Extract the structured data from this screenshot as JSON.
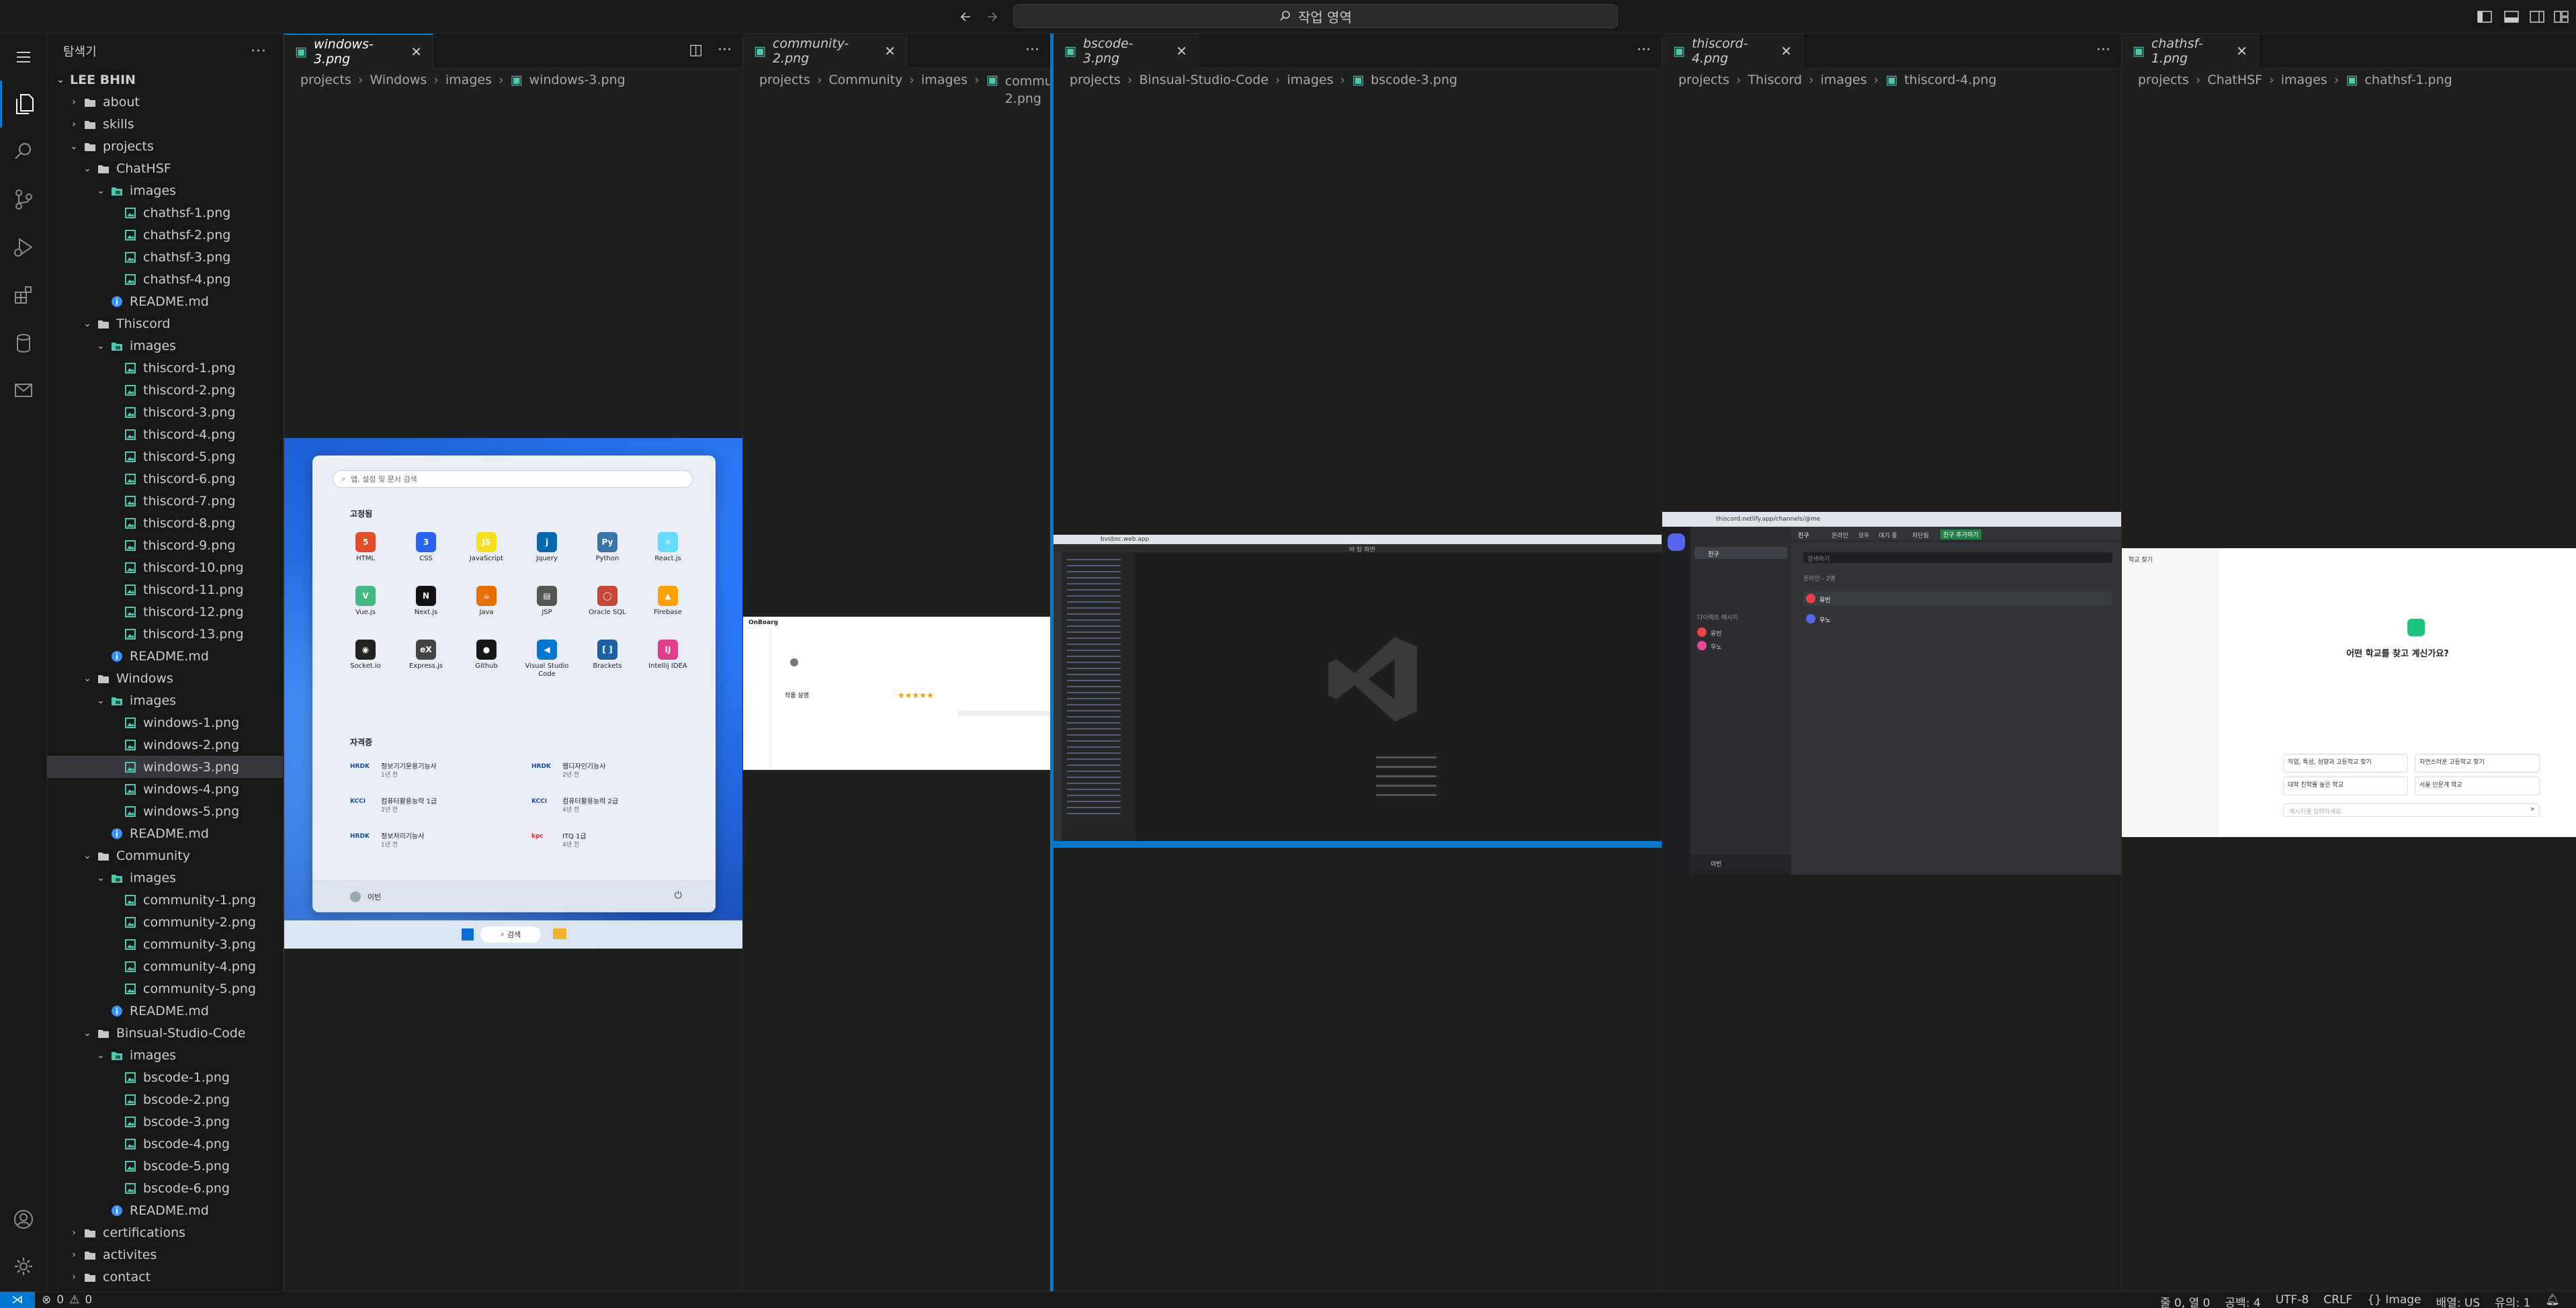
{
  "titlebar": {
    "search": "작업 영역"
  },
  "sidebar": {
    "title": "탐색기",
    "root": "LEE BHIN",
    "rows": [
      {
        "label": "about",
        "kind": "folder",
        "open": false,
        "depth": 1
      },
      {
        "label": "skills",
        "kind": "folder",
        "open": false,
        "depth": 1
      },
      {
        "label": "projects",
        "kind": "folder",
        "open": true,
        "depth": 1
      },
      {
        "label": "ChatHSF",
        "kind": "folder",
        "open": true,
        "depth": 2
      },
      {
        "label": "images",
        "kind": "imgfolder",
        "open": true,
        "depth": 3
      },
      {
        "label": "chathsf-1.png",
        "kind": "image",
        "depth": 4
      },
      {
        "label": "chathsf-2.png",
        "kind": "image",
        "depth": 4
      },
      {
        "label": "chathsf-3.png",
        "kind": "image",
        "depth": 4
      },
      {
        "label": "chathsf-4.png",
        "kind": "image",
        "depth": 4
      },
      {
        "label": "README.md",
        "kind": "info",
        "depth": 3
      },
      {
        "label": "Thiscord",
        "kind": "folder",
        "open": true,
        "depth": 2
      },
      {
        "label": "images",
        "kind": "imgfolder",
        "open": true,
        "depth": 3
      },
      {
        "label": "thiscord-1.png",
        "kind": "image",
        "depth": 4
      },
      {
        "label": "thiscord-2.png",
        "kind": "image",
        "depth": 4
      },
      {
        "label": "thiscord-3.png",
        "kind": "image",
        "depth": 4
      },
      {
        "label": "thiscord-4.png",
        "kind": "image",
        "depth": 4
      },
      {
        "label": "thiscord-5.png",
        "kind": "image",
        "depth": 4
      },
      {
        "label": "thiscord-6.png",
        "kind": "image",
        "depth": 4
      },
      {
        "label": "thiscord-7.png",
        "kind": "image",
        "depth": 4
      },
      {
        "label": "thiscord-8.png",
        "kind": "image",
        "depth": 4
      },
      {
        "label": "thiscord-9.png",
        "kind": "image",
        "depth": 4
      },
      {
        "label": "thiscord-10.png",
        "kind": "image",
        "depth": 4
      },
      {
        "label": "thiscord-11.png",
        "kind": "image",
        "depth": 4
      },
      {
        "label": "thiscord-12.png",
        "kind": "image",
        "depth": 4
      },
      {
        "label": "thiscord-13.png",
        "kind": "image",
        "depth": 4
      },
      {
        "label": "README.md",
        "kind": "info",
        "depth": 3
      },
      {
        "label": "Windows",
        "kind": "folder",
        "open": true,
        "depth": 2
      },
      {
        "label": "images",
        "kind": "imgfolder",
        "open": true,
        "depth": 3
      },
      {
        "label": "windows-1.png",
        "kind": "image",
        "depth": 4
      },
      {
        "label": "windows-2.png",
        "kind": "image",
        "depth": 4
      },
      {
        "label": "windows-3.png",
        "kind": "image",
        "depth": 4,
        "selected": true
      },
      {
        "label": "windows-4.png",
        "kind": "image",
        "depth": 4
      },
      {
        "label": "windows-5.png",
        "kind": "image",
        "depth": 4
      },
      {
        "label": "README.md",
        "kind": "info",
        "depth": 3
      },
      {
        "label": "Community",
        "kind": "folder",
        "open": true,
        "depth": 2
      },
      {
        "label": "images",
        "kind": "imgfolder",
        "open": true,
        "depth": 3
      },
      {
        "label": "community-1.png",
        "kind": "image",
        "depth": 4
      },
      {
        "label": "community-2.png",
        "kind": "image",
        "depth": 4
      },
      {
        "label": "community-3.png",
        "kind": "image",
        "depth": 4
      },
      {
        "label": "community-4.png",
        "kind": "image",
        "depth": 4
      },
      {
        "label": "community-5.png",
        "kind": "image",
        "depth": 4
      },
      {
        "label": "README.md",
        "kind": "info",
        "depth": 3
      },
      {
        "label": "Binsual-Studio-Code",
        "kind": "folder",
        "open": true,
        "depth": 2
      },
      {
        "label": "images",
        "kind": "imgfolder",
        "open": true,
        "depth": 3
      },
      {
        "label": "bscode-1.png",
        "kind": "image",
        "depth": 4
      },
      {
        "label": "bscode-2.png",
        "kind": "image",
        "depth": 4
      },
      {
        "label": "bscode-3.png",
        "kind": "image",
        "depth": 4
      },
      {
        "label": "bscode-4.png",
        "kind": "image",
        "depth": 4
      },
      {
        "label": "bscode-5.png",
        "kind": "image",
        "depth": 4
      },
      {
        "label": "bscode-6.png",
        "kind": "image",
        "depth": 4
      },
      {
        "label": "README.md",
        "kind": "info",
        "depth": 3
      },
      {
        "label": "certifications",
        "kind": "folder",
        "open": false,
        "depth": 1
      },
      {
        "label": "activites",
        "kind": "folder",
        "open": false,
        "depth": 1
      },
      {
        "label": "contact",
        "kind": "folder",
        "open": false,
        "depth": 1
      }
    ]
  },
  "groups": [
    {
      "tab": "windows-3.png",
      "crumb": [
        "projects",
        "Windows",
        "images",
        "windows-3.png"
      ]
    },
    {
      "tab": "community-2.png",
      "crumb": [
        "projects",
        "Community",
        "images",
        "communi"
      ],
      "crumb2": "2.png"
    },
    {
      "tab": "bscode-3.png",
      "crumb": [
        "projects",
        "Binsual-Studio-Code",
        "images",
        "bscode-3.png"
      ]
    },
    {
      "tab": "thiscord-4.png",
      "crumb": [
        "projects",
        "Thiscord",
        "images",
        "thiscord-4.png"
      ]
    },
    {
      "tab": "chathsf-1.png",
      "crumb": [
        "projects",
        "ChatHSF",
        "images",
        "chathsf-1.png"
      ]
    }
  ],
  "startmenu": {
    "search": "앱, 설정 및 문서 검색",
    "pinned_title": "고정됨",
    "apps": [
      {
        "name": "HTML",
        "icon": "5",
        "color": "#e44d26"
      },
      {
        "name": "CSS",
        "icon": "3",
        "color": "#2965f1"
      },
      {
        "name": "JavaScript",
        "icon": "JS",
        "color": "#f7df1e"
      },
      {
        "name": "Jquery",
        "icon": "j",
        "color": "#0769ad"
      },
      {
        "name": "Python",
        "icon": "Py",
        "color": "#3776ab"
      },
      {
        "name": "React.js",
        "icon": "⚛",
        "color": "#61dafb"
      },
      {
        "name": "Vue.js",
        "icon": "V",
        "color": "#42b883"
      },
      {
        "name": "Next.js",
        "icon": "N",
        "color": "#111111"
      },
      {
        "name": "Java",
        "icon": "☕",
        "color": "#e76f00"
      },
      {
        "name": "JSP",
        "icon": "▤",
        "color": "#555555"
      },
      {
        "name": "Oracle SQL",
        "icon": "◯",
        "color": "#c74634"
      },
      {
        "name": "Firebase",
        "icon": "▲",
        "color": "#ffa000"
      },
      {
        "name": "Socket.io",
        "icon": "◉",
        "color": "#222222"
      },
      {
        "name": "Express.js",
        "icon": "eX",
        "color": "#444444"
      },
      {
        "name": "Github",
        "icon": "●",
        "color": "#181717"
      },
      {
        "name": "Visual Studio Code",
        "icon": "◀",
        "color": "#0078d4"
      },
      {
        "name": "Brackets",
        "icon": "[ ]",
        "color": "#1f5fa3"
      },
      {
        "name": "Intellij IDEA",
        "icon": "IJ",
        "color": "#e03c8a"
      }
    ],
    "certs_title": "자격증",
    "certs": [
      {
        "name": "정보기기운용기능사",
        "sub": "1년 전",
        "org": "HRDK"
      },
      {
        "name": "웹디자인기능사",
        "sub": "2년 전",
        "org": "HRDK"
      },
      {
        "name": "컴퓨터활용능력 1급",
        "sub": "2년 전",
        "org": "KCCI"
      },
      {
        "name": "컴퓨터활용능력 2급",
        "sub": "4년 전",
        "org": "KCCI"
      },
      {
        "name": "정보처리기능사",
        "sub": "1년 전",
        "org": "HRDK"
      },
      {
        "name": "ITQ 1급",
        "sub": "4년 전",
        "org": "kpc"
      }
    ],
    "user": "이빈",
    "taskbar_search": "검색"
  },
  "community": {
    "logo": "OnBoarg",
    "title": "작품 설명",
    "stars": "★★★★★"
  },
  "bscode": {
    "url": "bvsbsc.web.app",
    "title": "바 탕 화면"
  },
  "thiscord": {
    "url": "thiscord.netlify.app/channels/@me",
    "friends": "친구",
    "online": "온라인",
    "all": "모두",
    "pending": "대기 중",
    "blocked": "차단됨",
    "add": "친구 추가하기",
    "search": "검색하기",
    "dm_title": "다이렉트 메시지",
    "friend1": "유빈",
    "friend2": "우노",
    "user": "이빈",
    "section": "온라인 - 2명"
  },
  "chathsf": {
    "header": "학교 찾기",
    "question": "어떤 학교를 찾고 계신가요?",
    "s1": "직업, 특성, 성향과 고등학교 찾기",
    "s2": "자연스러운 고등학교 찾기",
    "s3": "대학 진학률 높은 학교",
    "s4": "서울 인문계 학교",
    "input": "메시지를 입력하세요"
  },
  "status": {
    "errors": "0",
    "warnings": "0",
    "position": "줄 0, 열 0",
    "spaces": "공백: 4",
    "encoding": "UTF-8",
    "eol": "CRLF",
    "lang": "Image",
    "layout": "배열: US",
    "zoom": "유의: 1"
  }
}
